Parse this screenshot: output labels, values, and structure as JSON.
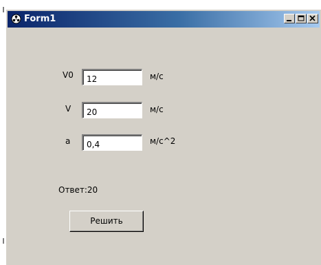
{
  "window": {
    "title": "Form1",
    "controls": [
      "minimize",
      "maximize",
      "close"
    ]
  },
  "form": {
    "fields": [
      {
        "label": "V0",
        "value": "12",
        "unit": "м/с"
      },
      {
        "label": "V",
        "value": "20",
        "unit": "м/с"
      },
      {
        "label": "a",
        "value": "0,4",
        "unit": "м/с^2"
      }
    ],
    "answer_text": "Ответ:20",
    "solve_button": "Решить"
  },
  "colors": {
    "face": "#d4d0c8",
    "title_start": "#0a246a",
    "title_end": "#a6caf0"
  }
}
